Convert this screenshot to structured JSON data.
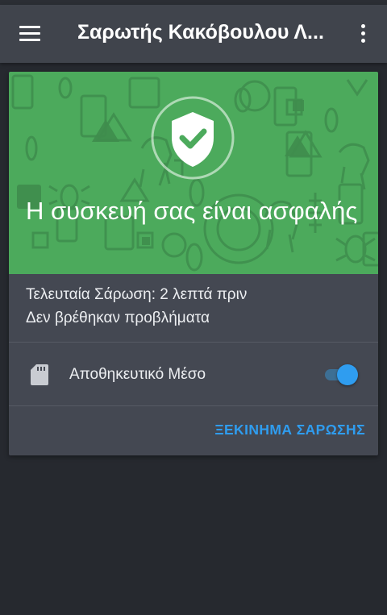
{
  "app_bar": {
    "title": "Σαρωτής Κακόβουλου Λ...",
    "menu_icon": "hamburger-menu-icon",
    "overflow_icon": "more-vert-icon"
  },
  "status_card": {
    "hero_color": "#4caa5c",
    "shield_icon": "shield-check-icon",
    "status_text": "Η συσκευή σας είναι ασφαλής",
    "last_scan": "Τελευταία Σάρωση: 2 λεπτά πριν",
    "problems": "Δεν βρέθηκαν προβλήματα",
    "storage": {
      "icon": "sd-card-icon",
      "label": "Αποθηκευτικό Μέσο",
      "enabled": true
    },
    "scan_button": "ΞΕΚΙΝΗΜΑ ΣΑΡΩΣΗΣ"
  },
  "colors": {
    "accent": "#2f9df0",
    "background": "#26292f",
    "toolbar": "#40444c",
    "card": "#444852"
  }
}
